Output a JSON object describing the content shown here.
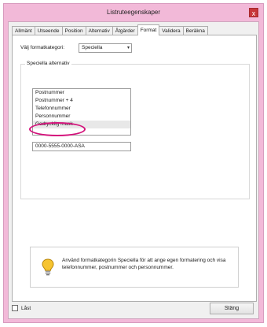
{
  "window": {
    "title": "Listruteegenskaper",
    "close_glyph": "x"
  },
  "tabs": [
    {
      "label": "Allmänt"
    },
    {
      "label": "Utseende"
    },
    {
      "label": "Position"
    },
    {
      "label": "Alternativ"
    },
    {
      "label": "Åtgärder"
    },
    {
      "label": "Format",
      "active": true
    },
    {
      "label": "Validera"
    },
    {
      "label": "Beräkna"
    }
  ],
  "format": {
    "category_label": "Välj formatkategori:",
    "category_value": "Speciella",
    "special_options_label": "Speciella alternativ",
    "options": [
      {
        "label": "Postnummer"
      },
      {
        "label": "Postnummer + 4"
      },
      {
        "label": "Telefonnummer"
      },
      {
        "label": "Personnummer"
      },
      {
        "label": "Godtycklig mask",
        "selected": true
      }
    ],
    "mask_value": "0000-5555-0000-ASA"
  },
  "tip": {
    "text": "Använd formatkategorin Speciella för att ange egen formatering och visa telefonnummer, postnummer och personnummer."
  },
  "footer": {
    "locked_label": "Låst",
    "close_label": "Stäng"
  },
  "colors": {
    "title_bar": "#f2b9d8",
    "close_button": "#c7363a",
    "highlight": "#d4127b"
  },
  "icons": {
    "tip": "lightbulb-icon",
    "close": "close-icon",
    "dropdown": "chevron-down-icon"
  }
}
